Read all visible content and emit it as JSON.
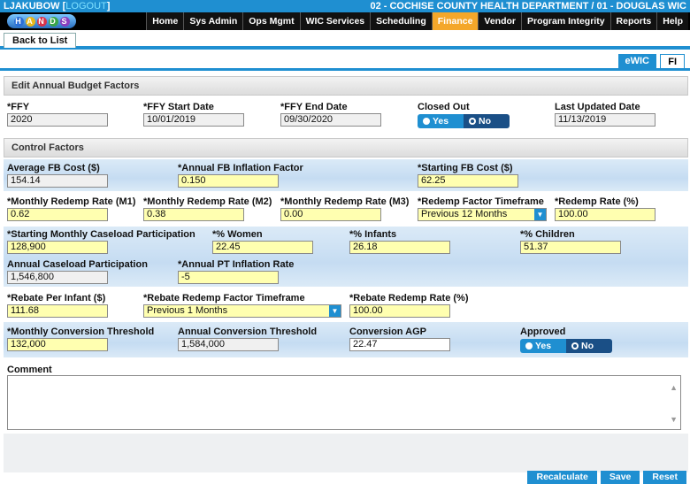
{
  "header": {
    "user": "LJAKUBOW [",
    "logout": "LOGOUT",
    "user_close": "]",
    "agency": "02 - COCHISE COUNTY HEALTH DEPARTMENT / 01 - DOUGLAS WIC",
    "logo_letters": [
      "H",
      "A",
      "N",
      "D",
      "S"
    ]
  },
  "nav": [
    "Home",
    "Sys Admin",
    "Ops Mgmt",
    "WIC Services",
    "Scheduling",
    "Finance",
    "Vendor",
    "Program Integrity",
    "Reports",
    "Help"
  ],
  "nav_active": "Finance",
  "back_label": "Back to List",
  "toggles": {
    "ewic": "eWIC",
    "fi": "FI"
  },
  "section1": {
    "title": "Edit Annual Budget Factors",
    "ffy": {
      "label": "*FFY",
      "value": "2020"
    },
    "start": {
      "label": "*FFY Start Date",
      "value": "10/01/2019"
    },
    "end": {
      "label": "*FFY End Date",
      "value": "09/30/2020"
    },
    "closed": {
      "label": "Closed Out",
      "yes": "Yes",
      "no": "No"
    },
    "updated": {
      "label": "Last Updated Date",
      "value": "11/13/2019"
    }
  },
  "section2": {
    "title": "Control Factors",
    "avg_fb": {
      "label": "Average FB Cost ($)",
      "value": "154.14"
    },
    "annual_infl": {
      "label": "*Annual FB Inflation Factor",
      "value": "0.150"
    },
    "start_fb": {
      "label": "*Starting FB Cost ($)",
      "value": "62.25"
    },
    "m1": {
      "label": "*Monthly Redemp Rate (M1)",
      "value": "0.62"
    },
    "m2": {
      "label": "*Monthly Redemp Rate (M2)",
      "value": "0.38"
    },
    "m3": {
      "label": "*Monthly Redemp Rate (M3)",
      "value": "0.00"
    },
    "timeframe": {
      "label": "*Redemp Factor Timeframe",
      "value": "Previous 12 Months"
    },
    "redemp_rate": {
      "label": "*Redemp Rate (%)",
      "value": "100.00"
    },
    "caseload": {
      "label": "*Starting Monthly Caseload Participation",
      "value": "128,900"
    },
    "women": {
      "label": "*% Women",
      "value": "22.45"
    },
    "infants": {
      "label": "*% Infants",
      "value": "26.18"
    },
    "children": {
      "label": "*% Children",
      "value": "51.37"
    },
    "annual_case": {
      "label": "Annual Caseload Participation",
      "value": "1,546,800"
    },
    "pt_infl": {
      "label": "*Annual PT Inflation Rate",
      "value": "-5"
    },
    "rebate_infant": {
      "label": "*Rebate Per Infant ($)",
      "value": "111.68"
    },
    "rebate_tf": {
      "label": "*Rebate Redemp Factor Timeframe",
      "value": "Previous 1 Months"
    },
    "rebate_rate": {
      "label": "*Rebate Redemp Rate (%)",
      "value": "100.00"
    },
    "monthly_conv": {
      "label": "*Monthly Conversion Threshold",
      "value": "132,000"
    },
    "annual_conv": {
      "label": "Annual Conversion Threshold",
      "value": "1,584,000"
    },
    "conv_agp": {
      "label": "Conversion AGP",
      "value": "22.47"
    },
    "approved": {
      "label": "Approved",
      "yes": "Yes",
      "no": "No"
    },
    "comment": {
      "label": "Comment",
      "value": ""
    }
  },
  "buttons": {
    "recalc": "Recalculate",
    "save": "Save",
    "reset": "Reset"
  }
}
